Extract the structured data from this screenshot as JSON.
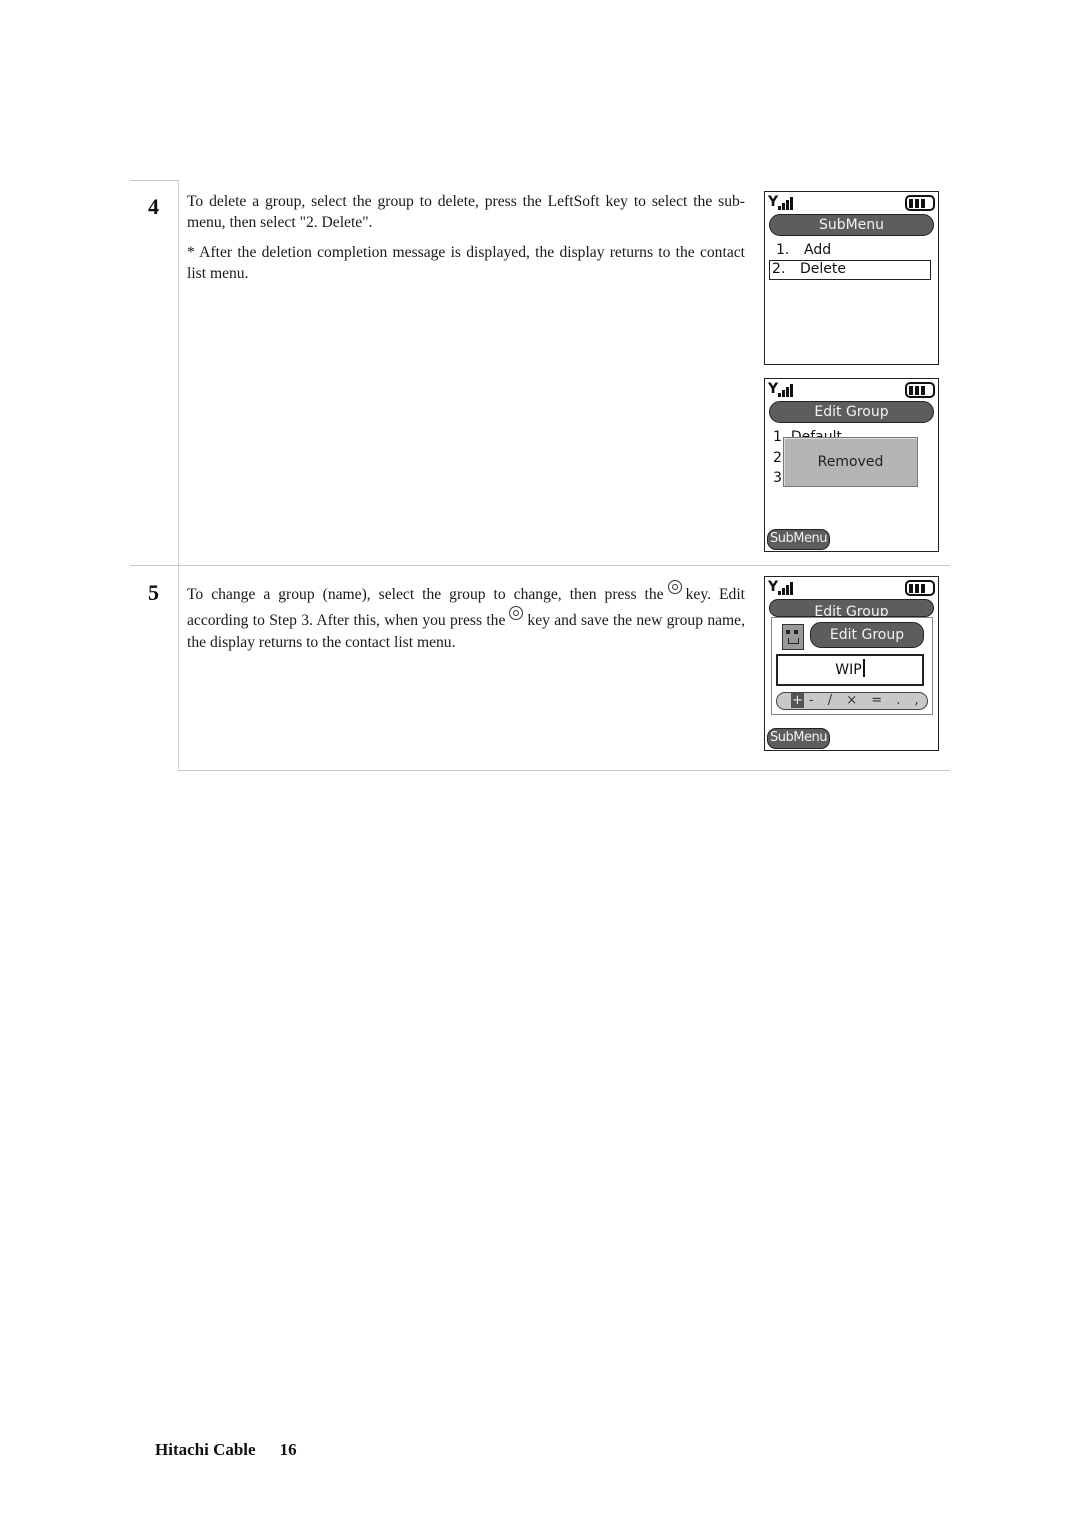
{
  "steps": [
    {
      "number": "4",
      "paragraphs": [
        "To delete a group, select the group to delete, press the LeftSoft key to select the sub-menu, then select \"2. Delete\".",
        "* After the deletion completion message is displayed, the display returns to the contact list menu."
      ],
      "screens": [
        {
          "title": "SubMenu",
          "items": [
            {
              "num": "1.",
              "label": "Add",
              "selected": false
            },
            {
              "num": "2.",
              "label": "Delete",
              "selected": true
            }
          ]
        },
        {
          "title": "Edit Group",
          "background_items": [
            "1",
            "2",
            "3"
          ],
          "background_item_partial": "Default",
          "popup": "Removed",
          "softkey": "SubMenu"
        }
      ]
    },
    {
      "number": "5",
      "text_part1": "To change a group (name), select the group to change, then press the",
      "text_part2": "key. Edit according to Step 3. After this, when you press the",
      "text_part3": "key and save the new group name, the display returns to the contact list menu.",
      "key_icon": "ok-key-icon",
      "screen": {
        "title_behind": "Edit Group",
        "title": "Edit Group",
        "input_value": "WIP",
        "symbols_highlight": "+",
        "symbols": "- / × = . ,",
        "softkey": "SubMenu"
      }
    }
  ],
  "footer": {
    "brand": "Hitachi Cable",
    "page": "16"
  }
}
